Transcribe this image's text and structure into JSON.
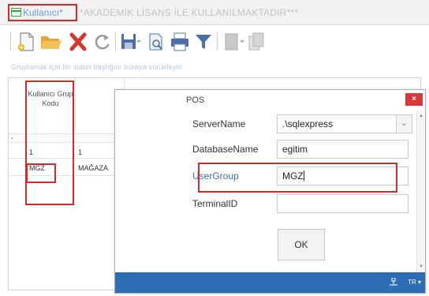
{
  "window": {
    "title": "Kullanıcı*",
    "subtitle": "*AKADEMİK LİSANS İLE KULLANILMAKTADIR***"
  },
  "toolbar": {
    "icons": [
      "new-document-icon",
      "open-folder-icon",
      "delete-icon",
      "refresh-icon",
      "save-icon",
      "print-preview-icon",
      "print-icon",
      "filter-icon",
      "columns-icon",
      "copy-icon"
    ]
  },
  "grid": {
    "group_hint": "Gruplamak için bir sütun başlığını buraya sürükleyin",
    "columns": [
      {
        "label": "Kullanıcı Grup Kodu"
      }
    ],
    "filter_row_symbol": "ꞏ",
    "rows": [
      {
        "code": "1",
        "name": "1"
      },
      {
        "code": "MGZ",
        "name": "MAĞAZA"
      }
    ]
  },
  "dialog": {
    "title": "POS",
    "close_label": "×",
    "fields": {
      "server_name_label": "ServerName",
      "server_name_value": ".\\sqlexpress",
      "database_name_label": "DatabaseName",
      "database_name_value": "egitim",
      "user_group_label": "UserGroup",
      "user_group_value": "MGZ",
      "terminal_id_label": "TerminalID",
      "terminal_id_value": ""
    },
    "ok_label": "OK",
    "status": {
      "lang": "TR"
    }
  },
  "colors": {
    "highlight": "#d62a2a",
    "title_blue": "#6ba1d8",
    "status_bar": "#2d6db4",
    "close_red": "#d63a3a"
  }
}
